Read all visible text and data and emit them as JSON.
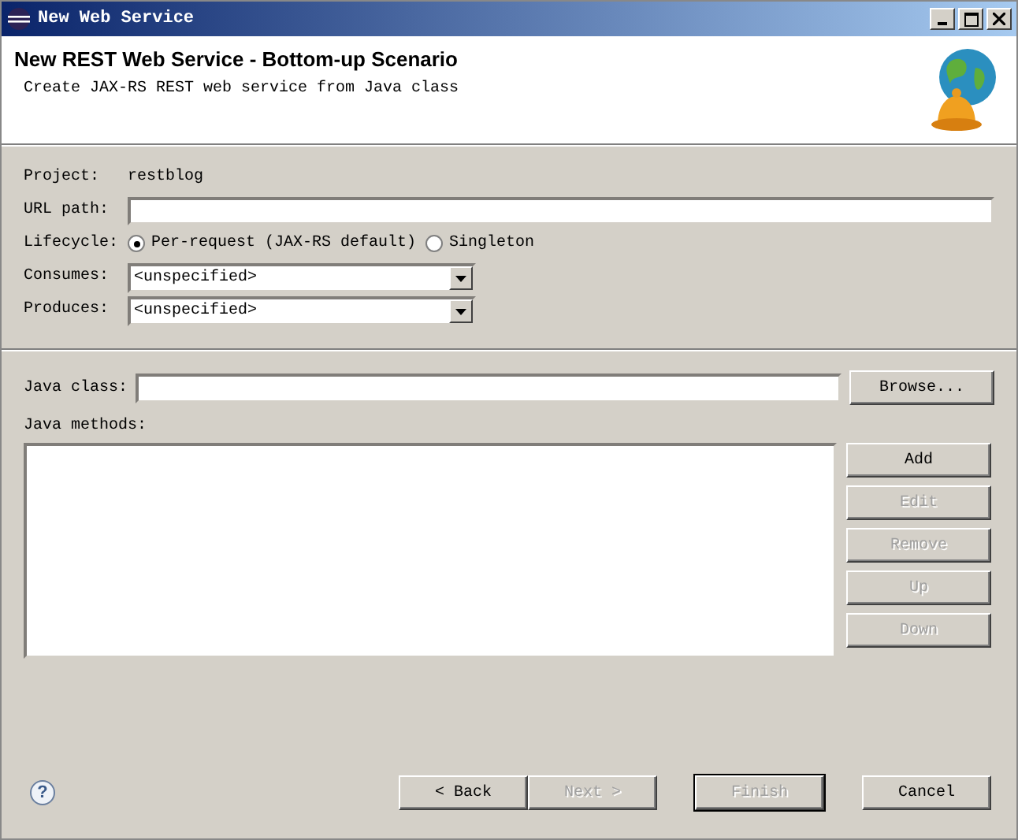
{
  "window": {
    "title": "New Web Service"
  },
  "header": {
    "title": "New REST Web Service - Bottom-up Scenario",
    "description": "Create JAX-RS REST web service from Java class"
  },
  "project": {
    "label": "Project:",
    "value": "restblog"
  },
  "url_path": {
    "label": "URL path:"
  },
  "lifecycle": {
    "label": "Lifecycle:",
    "options": [
      {
        "label": "Per-request (JAX-RS default)",
        "selected": true
      },
      {
        "label": "Singleton",
        "selected": false
      }
    ]
  },
  "consumes": {
    "label": "Consumes:",
    "value": "<unspecified>"
  },
  "produces": {
    "label": "Produces:",
    "value": "<unspecified>"
  },
  "java_class": {
    "label": "Java class:",
    "button": "Browse..."
  },
  "java_methods": {
    "label": "Java methods:",
    "buttons": [
      {
        "label": "Add",
        "disabled": false
      },
      {
        "label": "Edit",
        "disabled": true
      },
      {
        "label": "Remove",
        "disabled": true
      },
      {
        "label": "Up",
        "disabled": true
      },
      {
        "label": "Down",
        "disabled": true
      }
    ]
  },
  "help": "?",
  "footer_buttons": [
    {
      "label": "< Back",
      "disabled": false,
      "default": false
    },
    {
      "label": "Next >",
      "disabled": true,
      "default": false
    },
    {
      "label": "Finish",
      "disabled": true,
      "default": true
    },
    {
      "label": "Cancel",
      "disabled": false,
      "default": false
    }
  ]
}
